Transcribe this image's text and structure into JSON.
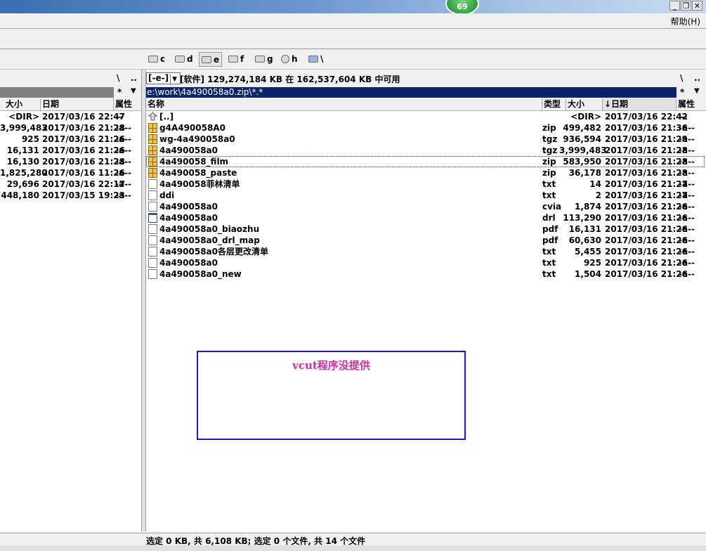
{
  "titlebar": {
    "badge": "69",
    "minimize": "_",
    "restore": "❐",
    "close": "✕"
  },
  "menubar": {
    "help": "帮助(H)"
  },
  "drives": [
    {
      "label": "c"
    },
    {
      "label": "d"
    },
    {
      "label": "e",
      "active": true
    },
    {
      "label": "f"
    },
    {
      "label": "g"
    },
    {
      "label": "h"
    },
    {
      "label": "\\"
    }
  ],
  "left_panel": {
    "path_root": "\\",
    "path_up": "..",
    "filter_star": "*",
    "filter_arrow": "▼",
    "columns": {
      "size": "大小",
      "date": "日期",
      "attr": "属性"
    },
    "rows": [
      {
        "size": "<DIR>",
        "date": "2017/03/16 22:47",
        "attr": "—"
      },
      {
        "size": "3,999,483",
        "date": "2017/03/16 21:28",
        "attr": "-a--"
      },
      {
        "size": "925",
        "date": "2017/03/16 21:26",
        "attr": "-a--"
      },
      {
        "size": "16,131",
        "date": "2017/03/16 21:26",
        "attr": "-a--"
      },
      {
        "size": "16,130",
        "date": "2017/03/16 21:28",
        "attr": "-a--"
      },
      {
        "size": "1,825,280",
        "date": "2017/03/16 11:26",
        "attr": "-a--"
      },
      {
        "size": "29,696",
        "date": "2017/03/16 22:17",
        "attr": "-a--"
      },
      {
        "size": "448,180",
        "date": "2017/03/15 19:23",
        "attr": "-a--"
      }
    ]
  },
  "right_panel": {
    "drive_select": "[-e-]",
    "drive_info": "[软件]  129,274,184 KB 在 162,537,604 KB 中可用",
    "path_root": "\\",
    "path_up": "..",
    "current_path": "e:\\work\\4a490058a0.zip\\*.*",
    "filter_star": "*",
    "filter_arrow": "▼",
    "columns": {
      "name": "名称",
      "type": "类型",
      "size": "大小",
      "date": "↓日期",
      "attr": "属性"
    },
    "rows": [
      {
        "icon": "up",
        "name": "[..]",
        "type": "",
        "size": "<DIR>",
        "date": "2017/03/16 22:42",
        "attr": "—"
      },
      {
        "icon": "zip",
        "name": "g4A490058A0",
        "type": "zip",
        "size": "499,482",
        "date": "2017/03/16 21:36",
        "attr": "-a--"
      },
      {
        "icon": "zip",
        "name": "wg-4a490058a0",
        "type": "tgz",
        "size": "936,594",
        "date": "2017/03/16 21:29",
        "attr": "-a--"
      },
      {
        "icon": "zip",
        "name": "4a490058a0",
        "type": "tgz",
        "size": "3,999,483",
        "date": "2017/03/16 21:28",
        "attr": "-a--"
      },
      {
        "icon": "zip",
        "name": "4a490058_film",
        "type": "zip",
        "size": "583,950",
        "date": "2017/03/16 21:28",
        "attr": "-a--",
        "focused": true
      },
      {
        "icon": "zip",
        "name": "4a490058_paste",
        "type": "zip",
        "size": "36,178",
        "date": "2017/03/16 21:28",
        "attr": "-a--"
      },
      {
        "icon": "txt",
        "name": "4a490058菲林清单",
        "type": "txt",
        "size": "14",
        "date": "2017/03/16 21:27",
        "attr": "-a--"
      },
      {
        "icon": "txt",
        "name": "ddi",
        "type": "txt",
        "size": "2",
        "date": "2017/03/16 21:27",
        "attr": "-a--"
      },
      {
        "icon": "txt",
        "name": "4a490058a0",
        "type": "cvia",
        "size": "1,874",
        "date": "2017/03/16 21:26",
        "attr": "-a--"
      },
      {
        "icon": "drl",
        "name": "4a490058a0",
        "type": "drl",
        "size": "113,290",
        "date": "2017/03/16 21:26",
        "attr": "-a--"
      },
      {
        "icon": "txt",
        "name": "4a490058a0_biaozhu",
        "type": "pdf",
        "size": "16,131",
        "date": "2017/03/16 21:26",
        "attr": "-a--"
      },
      {
        "icon": "txt",
        "name": "4a490058a0_drl_map",
        "type": "pdf",
        "size": "60,630",
        "date": "2017/03/16 21:26",
        "attr": "-a--"
      },
      {
        "icon": "txt",
        "name": "4a490058a0各层更改清单",
        "type": "txt",
        "size": "5,455",
        "date": "2017/03/16 21:26",
        "attr": "-a--"
      },
      {
        "icon": "txt",
        "name": "4a490058a0",
        "type": "txt",
        "size": "925",
        "date": "2017/03/16 21:26",
        "attr": "-a--"
      },
      {
        "icon": "txt",
        "name": "4a490058a0_new",
        "type": "txt",
        "size": "1,504",
        "date": "2017/03/16 21:26",
        "attr": "-a--"
      }
    ]
  },
  "overlay_box": {
    "text": "vcut程序没提供"
  },
  "status": {
    "text": "选定 0 KB, 共 6,108 KB; 选定 0 个文件, 共 14 个文件"
  },
  "colors": {
    "accent": "#0a246a",
    "box_border": "#1a1ad0",
    "box_text": "#cc2fa0"
  }
}
